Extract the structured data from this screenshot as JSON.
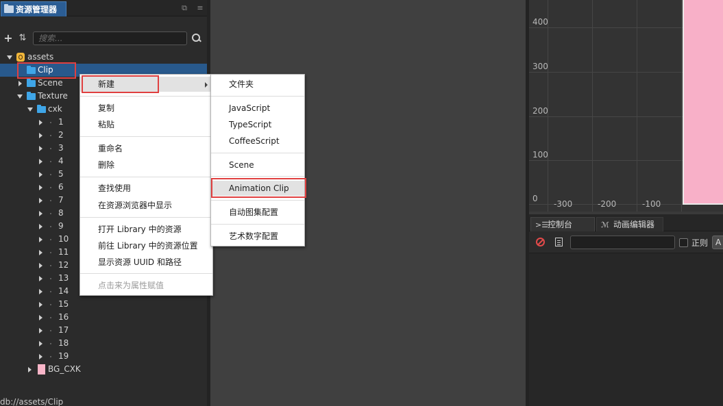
{
  "assets_panel": {
    "tab_label": "资源管理器",
    "search_placeholder": "搜索...",
    "tree": {
      "root": "assets",
      "clip": "Clip",
      "scene": "Scene",
      "texture": "Texture",
      "cxk": "cxk",
      "frames": [
        "1",
        "2",
        "3",
        "4",
        "5",
        "6",
        "7",
        "8",
        "9",
        "10",
        "11",
        "12",
        "13",
        "14",
        "15",
        "16",
        "17",
        "18",
        "19"
      ],
      "bg": "BG_CXK"
    },
    "status_path": "db://assets/Clip"
  },
  "context_menu": {
    "new": "新建",
    "copy": "复制",
    "paste": "粘贴",
    "rename": "重命名",
    "delete": "删除",
    "find_usage": "查找使用",
    "show_in_browser": "在资源浏览器中显示",
    "open_in_library": "打开 Library 中的资源",
    "goto_library": "前往 Library 中的资源位置",
    "show_uuid": "显示资源 UUID 和路径",
    "assign_property": "点击来为属性赋值"
  },
  "submenu": {
    "folder": "文件夹",
    "javascript": "JavaScript",
    "typescript": "TypeScript",
    "coffeescript": "CoffeeScript",
    "scene": "Scene",
    "animation_clip": "Animation Clip",
    "auto_atlas": "自动图集配置",
    "label_atlas": "艺术数字配置"
  },
  "scene_view": {
    "y_labels": [
      "400",
      "300",
      "200",
      "100",
      "0"
    ],
    "x_labels": [
      "-300",
      "-200",
      "-100"
    ],
    "canvas_color": "#f8b0c8"
  },
  "bottom_panel": {
    "tab_console": "控制台",
    "tab_animation": "动画编辑器",
    "regex_label": "正则",
    "level_value": "A"
  },
  "colors": {
    "selection": "#28598c",
    "highlight": "#e04040",
    "folder": "#3fa6e8"
  }
}
